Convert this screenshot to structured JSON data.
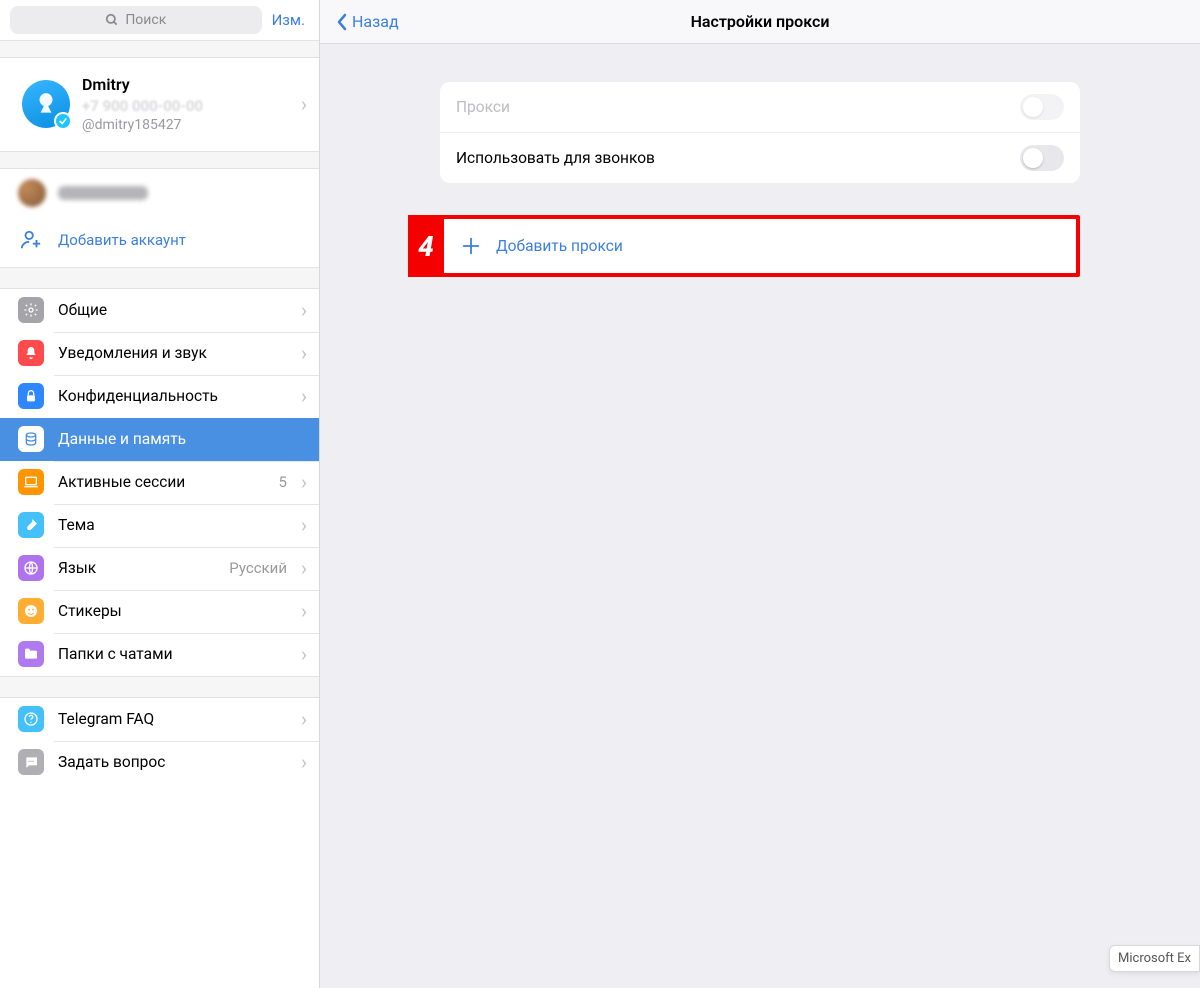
{
  "search": {
    "placeholder": "Поиск"
  },
  "edit_label": "Изм.",
  "profile": {
    "name": "Dmitry",
    "handle": "@dmitry185427"
  },
  "add_account_label": "Добавить аккаунт",
  "menu": {
    "general": "Общие",
    "notifications": "Уведомления и звук",
    "privacy": "Конфиденциальность",
    "data": "Данные и память",
    "sessions_label": "Активные сессии",
    "sessions_count": "5",
    "theme": "Тема",
    "language_label": "Язык",
    "language_value": "Русский",
    "stickers": "Стикеры",
    "folders": "Папки с чатами",
    "faq": "Telegram FAQ",
    "ask": "Задать вопрос"
  },
  "topbar": {
    "back": "Назад",
    "title": "Настройки прокси"
  },
  "card": {
    "proxy": "Прокси",
    "use_calls": "Использовать для звонков"
  },
  "add_proxy": "Добавить прокси",
  "step_number": "4",
  "notification_tip": "Microsoft Ex"
}
